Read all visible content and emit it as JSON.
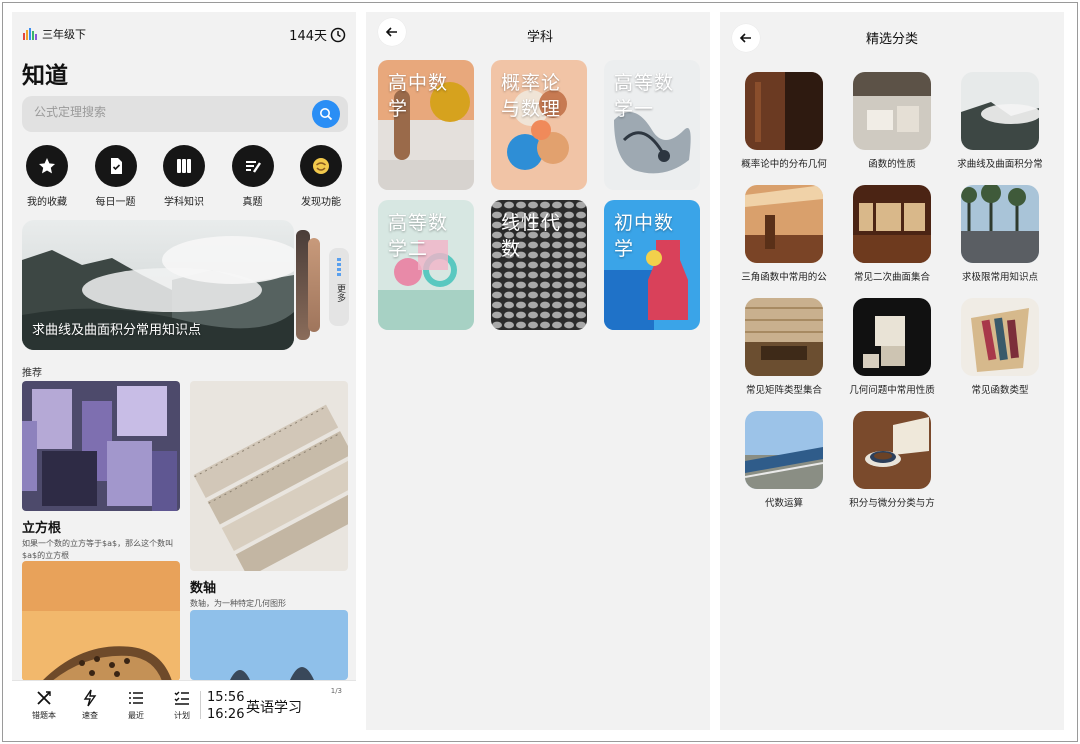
{
  "home": {
    "grade": "三年级下",
    "days": "144天",
    "app_title": "知道",
    "search_placeholder": "公式定理搜索",
    "quick_actions": [
      {
        "label": "我的收藏",
        "icon": "star-icon"
      },
      {
        "label": "每日一题",
        "icon": "daily-question-icon"
      },
      {
        "label": "学科知识",
        "icon": "books-icon"
      },
      {
        "label": "真题",
        "icon": "exam-icon"
      },
      {
        "label": "发现功能",
        "icon": "discover-icon"
      }
    ],
    "hero_title": "求曲线及曲面积分常用知识点",
    "more_label": "更多",
    "section_label": "推荐",
    "recommendations": [
      {
        "title": "立方根",
        "desc": "如果一个数的立方等于$a$，那么这个数叫$a$的立方根"
      },
      {
        "title": "数轴",
        "desc": "数轴，为一种特定几何图形"
      }
    ],
    "bottom_nav": [
      {
        "label": "错题本",
        "icon": "wrong-book-icon"
      },
      {
        "label": "速查",
        "icon": "lightning-icon"
      },
      {
        "label": "最近",
        "icon": "list-icon"
      },
      {
        "label": "计划",
        "icon": "plan-icon"
      }
    ],
    "schedule": {
      "start": "15:56",
      "end": "16:26",
      "course": "英语学习",
      "page": "1/3"
    }
  },
  "subjects": {
    "title": "学科",
    "items": [
      {
        "name": "高中数学"
      },
      {
        "name": "概率论与数理"
      },
      {
        "name": "高等数学一"
      },
      {
        "name": "高等数学二"
      },
      {
        "name": "线性代数"
      },
      {
        "name": "初中数学"
      }
    ]
  },
  "categories": {
    "title": "精选分类",
    "items": [
      {
        "label": "概率论中的分布几何"
      },
      {
        "label": "函数的性质"
      },
      {
        "label": "求曲线及曲面积分常"
      },
      {
        "label": "三角函数中常用的公"
      },
      {
        "label": "常见二次曲面集合"
      },
      {
        "label": "求极限常用知识点"
      },
      {
        "label": "常见矩阵类型集合"
      },
      {
        "label": "几何问题中常用性质"
      },
      {
        "label": "常见函数类型"
      },
      {
        "label": "代数运算"
      },
      {
        "label": "积分与微分分类与方"
      }
    ]
  },
  "colors": {
    "accent": "#2a8ef5",
    "panel_bg": "#f2f2f2",
    "icon_dark": "#161616"
  }
}
